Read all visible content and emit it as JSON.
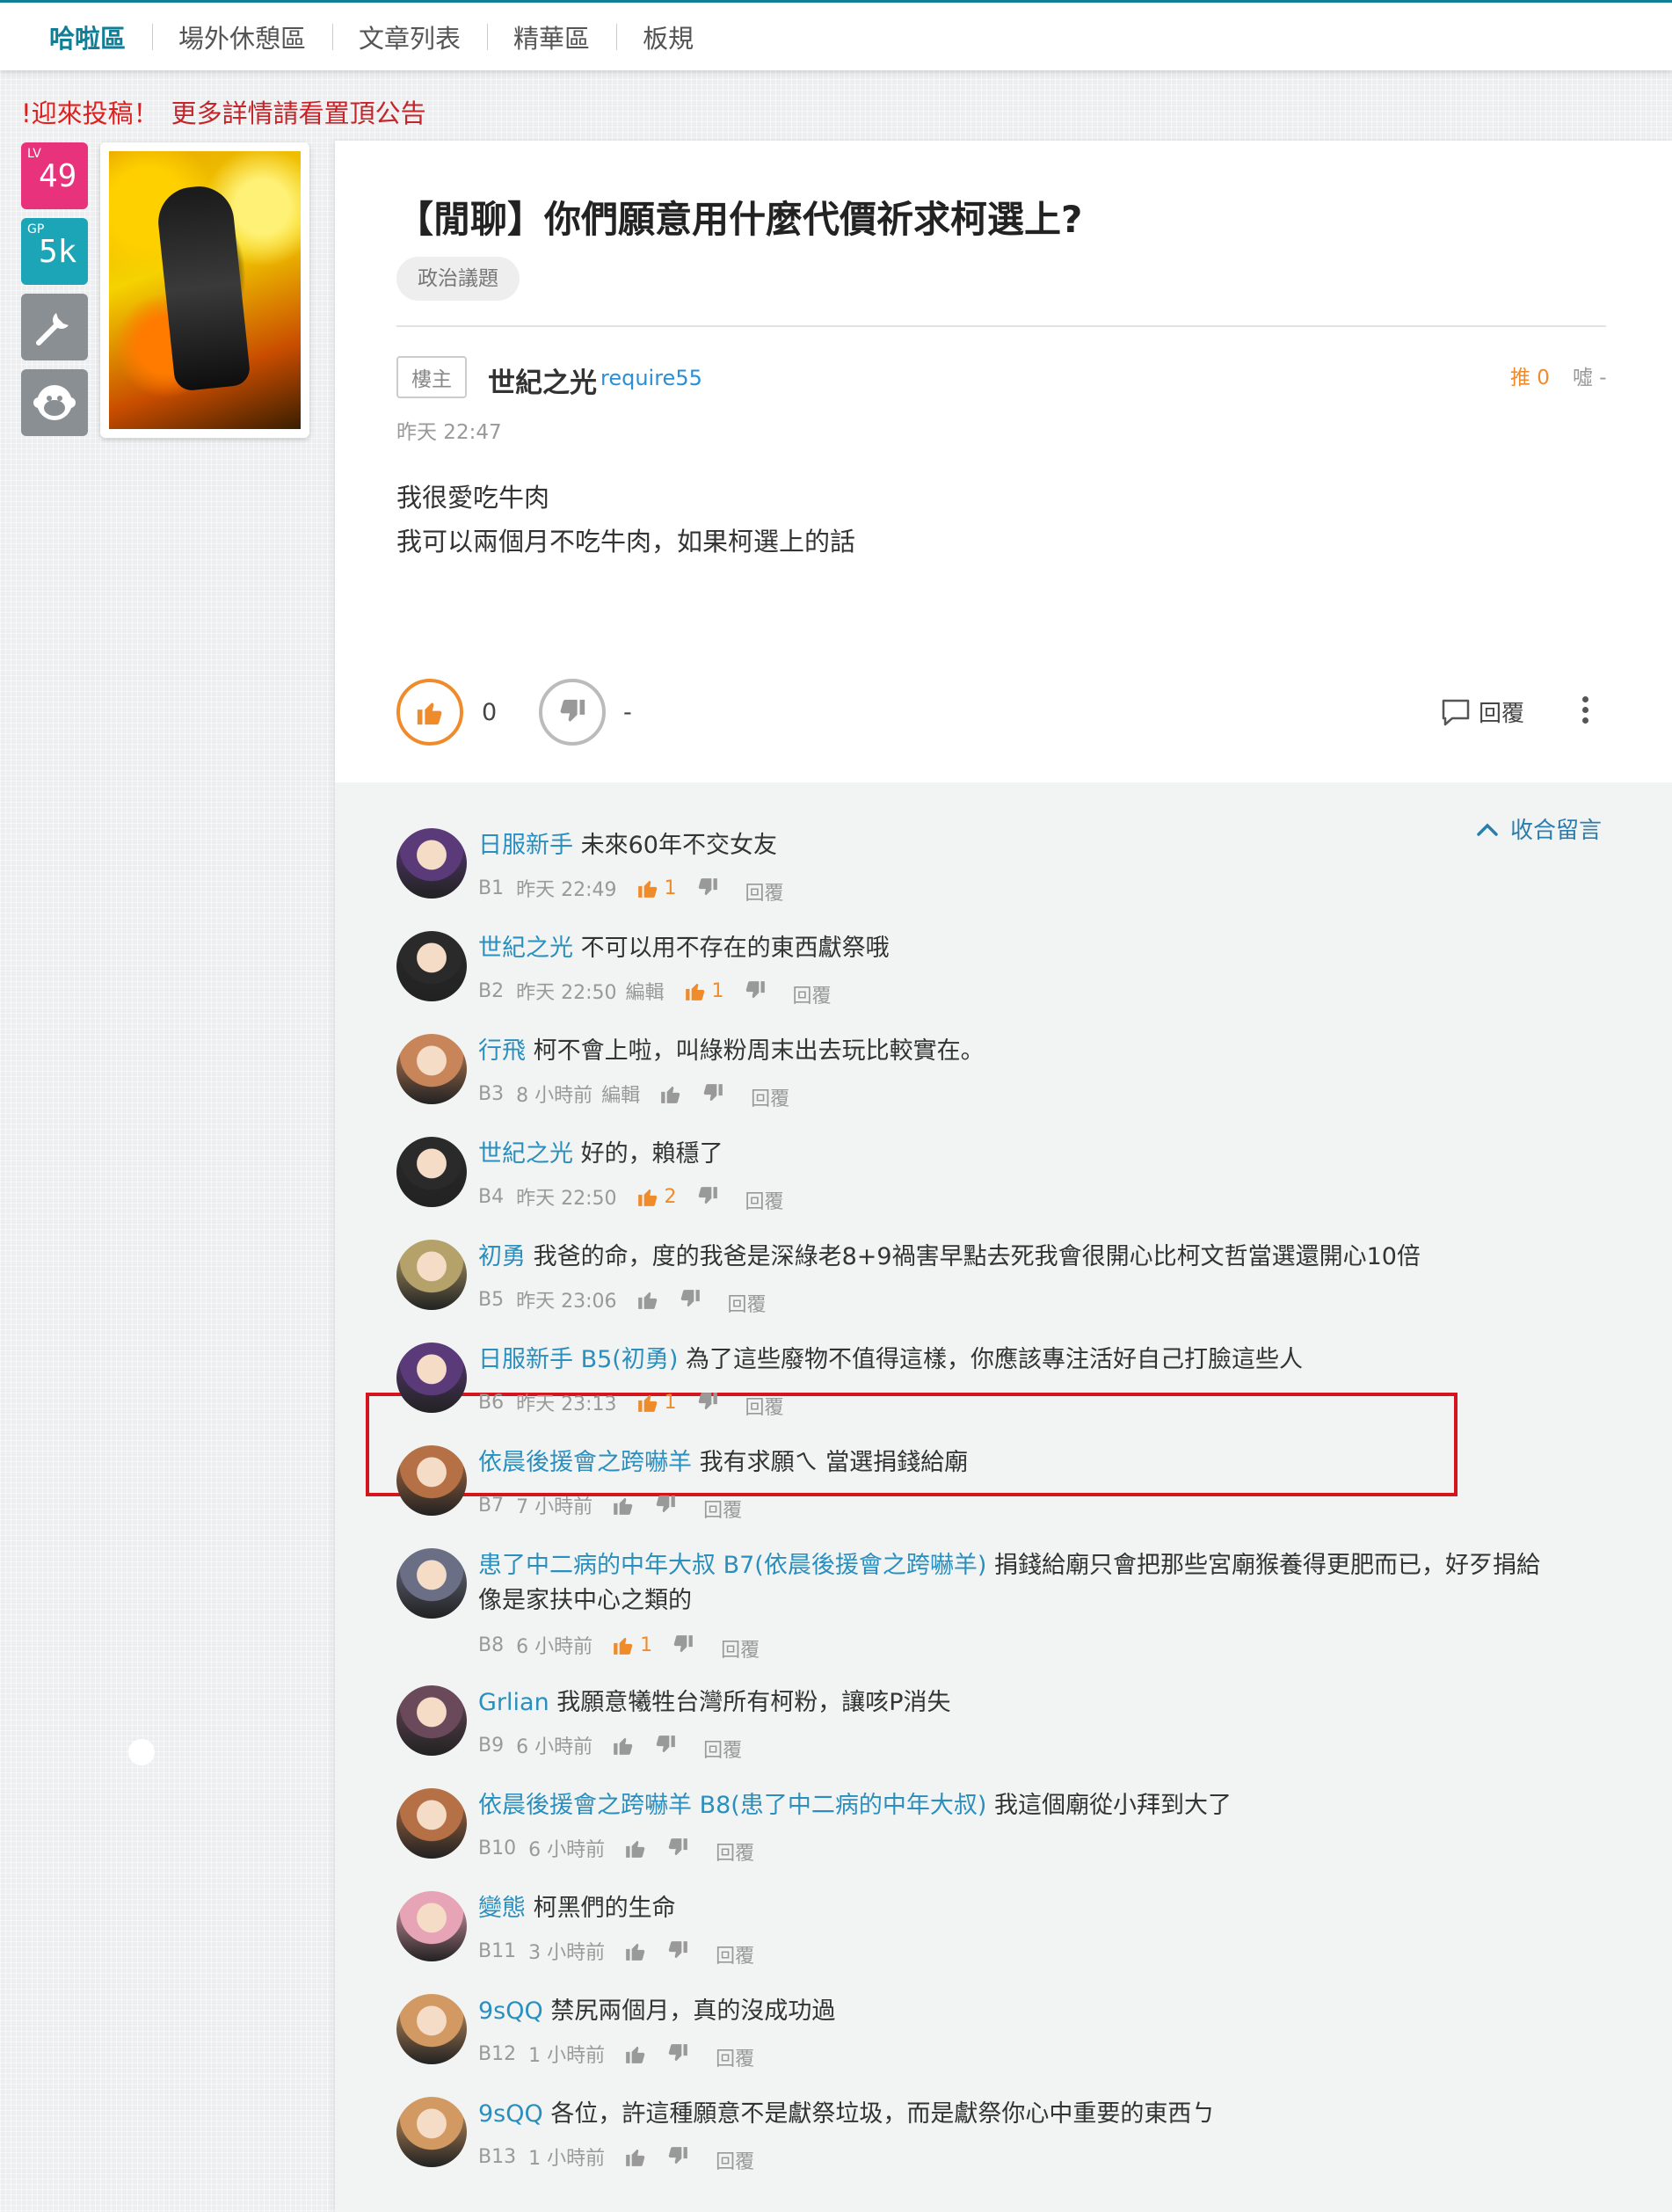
{
  "nav": {
    "items": [
      "哈啦區",
      "場外休憩區",
      "文章列表",
      "精華區",
      "板規"
    ],
    "active_index": 0
  },
  "notice": {
    "part1": "!迎來投稿！",
    "part2": "更多詳情請看置頂公告"
  },
  "profile": {
    "lv_tag": "LV",
    "lv_value": "49",
    "gp_tag": "GP",
    "gp_value": "5k",
    "icons": [
      "wrench-icon",
      "monkey-face-icon"
    ]
  },
  "post": {
    "title": "【閒聊】你們願意用什麼代價祈求柯選上?",
    "category_tag": "政治議題",
    "author_role": "樓主",
    "author_name": "世紀之光",
    "author_id": "require55",
    "push_label": "推 0",
    "boo_label": "噓 -",
    "time": "昨天 22:47",
    "body": [
      "我很愛吃牛肉",
      "我可以兩個月不吃牛肉，如果柯選上的話"
    ],
    "like_count": "0",
    "dislike_count": "-",
    "reply_label": "回覆"
  },
  "comments_section": {
    "collapse_label": "收合留言",
    "reply_label": "回覆",
    "items": [
      {
        "user": "日服新手",
        "reply_to": "",
        "text": "未來60年不交女友",
        "floor": "B1",
        "time": "昨天 22:49",
        "edited": "",
        "gp": "1",
        "avatar_color": "#5b3a7a"
      },
      {
        "user": "世紀之光",
        "reply_to": "",
        "text": "不可以用不存在的東西獻祭哦",
        "floor": "B2",
        "time": "昨天 22:50",
        "edited": "編輯",
        "gp": "1",
        "avatar_color": "#2a2a2a"
      },
      {
        "user": "行飛",
        "reply_to": "",
        "text": "柯不會上啦，叫綠粉周末出去玩比較實在。",
        "floor": "B3",
        "time": "8 小時前",
        "edited": "編輯",
        "gp": "",
        "avatar_color": "#c9855a"
      },
      {
        "user": "世紀之光",
        "reply_to": "",
        "text": "好的，賴穩了",
        "floor": "B4",
        "time": "昨天 22:50",
        "edited": "",
        "gp": "2",
        "avatar_color": "#2a2a2a"
      },
      {
        "user": "初勇",
        "reply_to": "",
        "text": "我爸的命，度的我爸是深綠老8+9禍害早點去死我會很開心比柯文哲當選還開心10倍",
        "floor": "B5",
        "time": "昨天 23:06",
        "edited": "",
        "gp": "",
        "avatar_color": "#b5a16a"
      },
      {
        "user": "日服新手",
        "reply_to": "B5(初勇)",
        "text": "為了這些廢物不值得這樣，你應該專注活好自己打臉這些人",
        "floor": "B6",
        "time": "昨天 23:13",
        "edited": "",
        "gp": "1",
        "avatar_color": "#5b3a7a"
      },
      {
        "user": "依晨後援會之跨嚇羊",
        "reply_to": "",
        "text": "我有求願ㄟ 當選捐錢給廟",
        "floor": "B7",
        "time": "7 小時前",
        "edited": "",
        "gp": "",
        "avatar_color": "#b57045"
      },
      {
        "user": "患了中二病的中年大叔",
        "reply_to": "B7(依晨後援會之跨嚇羊)",
        "text": "捐錢給廟只會把那些宮廟猴養得更肥而已，好歹捐給像是家扶中心之類的",
        "floor": "B8",
        "time": "6 小時前",
        "edited": "",
        "gp": "1",
        "avatar_color": "#6b6f86"
      },
      {
        "user": "Grlian",
        "reply_to": "",
        "text": "我願意犧牲台灣所有柯粉，讓咳P消失",
        "floor": "B9",
        "time": "6 小時前",
        "edited": "",
        "gp": "",
        "avatar_color": "#6a4a5a"
      },
      {
        "user": "依晨後援會之跨嚇羊",
        "reply_to": "B8(患了中二病的中年大叔)",
        "text": "我這個廟從小拜到大了",
        "floor": "B10",
        "time": "6 小時前",
        "edited": "",
        "gp": "",
        "avatar_color": "#b57045"
      },
      {
        "user": "變態",
        "reply_to": "",
        "text": "柯黑們的生命",
        "floor": "B11",
        "time": "3 小時前",
        "edited": "",
        "gp": "",
        "avatar_color": "#e7a4b6"
      },
      {
        "user": "9sQQ",
        "reply_to": "",
        "text": "禁尻兩個月，真的沒成功過",
        "floor": "B12",
        "time": "1 小時前",
        "edited": "",
        "gp": "",
        "avatar_color": "#d29a62"
      },
      {
        "user": "9sQQ",
        "reply_to": "",
        "text": "各位，許這種願意不是獻祭垃圾，而是獻祭你心中重要的東西ㄅ",
        "floor": "B13",
        "time": "1 小時前",
        "edited": "",
        "gp": "",
        "avatar_color": "#d29a62"
      }
    ]
  },
  "highlighted_comment": "B5",
  "colors": {
    "accent": "#117e96",
    "notice_red": "#e0201f",
    "username_blue": "#2b8fbe",
    "gp_orange": "#f08b2c",
    "highlight_red": "#d4151d",
    "lv_pink": "#e8327c",
    "gp_teal": "#1ba5b6"
  }
}
